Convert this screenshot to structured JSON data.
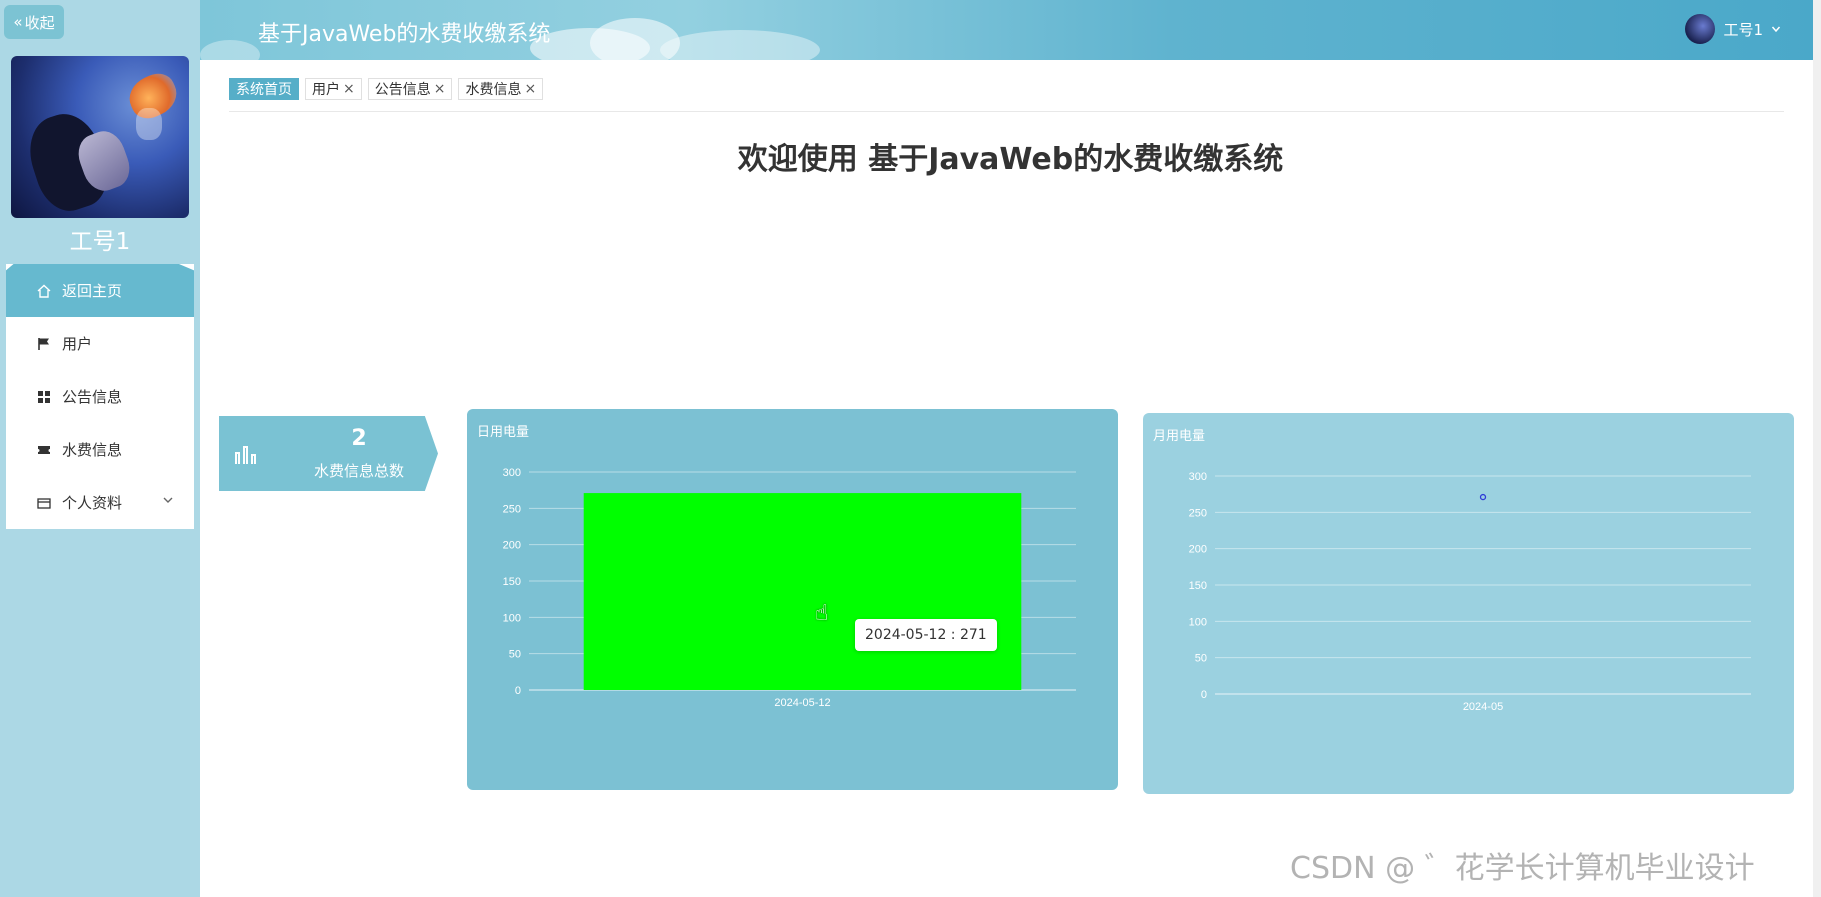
{
  "sidebar": {
    "collapse_label": "收起",
    "username": "工号1",
    "items": [
      {
        "label": "返回主页",
        "icon": "home-icon",
        "active": true
      },
      {
        "label": "用户",
        "icon": "flag-icon",
        "active": false
      },
      {
        "label": "公告信息",
        "icon": "grid-icon",
        "active": false
      },
      {
        "label": "水费信息",
        "icon": "ticket-icon",
        "active": false
      },
      {
        "label": "个人资料",
        "icon": "wallet-icon",
        "active": false,
        "has_submenu": true
      }
    ]
  },
  "header": {
    "title": "基于JavaWeb的水费收缴系统",
    "user_label": "工号1"
  },
  "tabs": [
    {
      "label": "系统首页",
      "active": true,
      "closable": false
    },
    {
      "label": "用户",
      "active": false,
      "closable": true
    },
    {
      "label": "公告信息",
      "active": false,
      "closable": true
    },
    {
      "label": "水费信息",
      "active": false,
      "closable": true
    }
  ],
  "welcome": "欢迎使用 基于JavaWeb的水费收缴系统",
  "stat": {
    "value": "2",
    "label": "水费信息总数",
    "icon": "bar-chart-icon"
  },
  "chart_data": [
    {
      "type": "bar",
      "title": "日用电量",
      "categories": [
        "2024-05-12"
      ],
      "values": [
        271
      ],
      "ylim": [
        0,
        300
      ],
      "yticks": [
        0,
        50,
        100,
        150,
        200,
        250,
        300
      ],
      "bar_color": "#00ff00",
      "grid": true,
      "tooltip": "2024-05-12 : 271"
    },
    {
      "type": "line",
      "title": "月用电量",
      "categories": [
        "2024-05"
      ],
      "values": [
        271
      ],
      "ylim": [
        0,
        300
      ],
      "yticks": [
        0,
        50,
        100,
        150,
        200,
        250,
        300
      ],
      "point_color": "#2f3bd6",
      "grid": true
    }
  ],
  "watermark": "CSDN @ ゛花学长计算机毕业设计",
  "colors": {
    "sidebar_bg": "#acd8e5",
    "accent": "#66b9cf",
    "panel_a": "#7cc1d3",
    "panel_b": "#9bd1e0"
  }
}
